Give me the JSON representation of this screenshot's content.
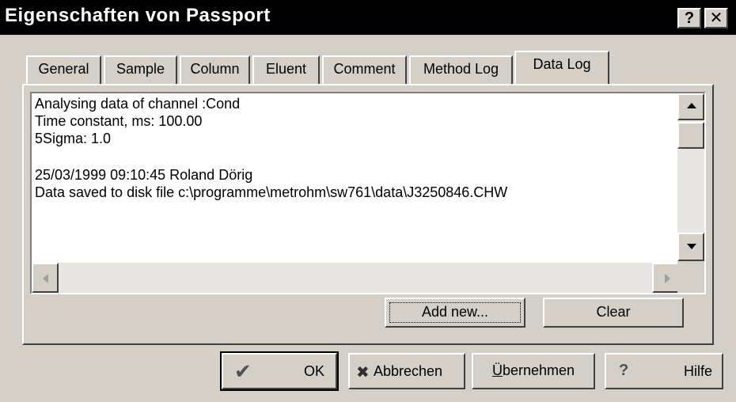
{
  "window": {
    "title": "Eigenschaften von Passport",
    "help_button": "?",
    "close_button": "✕"
  },
  "tabs": [
    {
      "label": "General"
    },
    {
      "label": "Sample"
    },
    {
      "label": "Column"
    },
    {
      "label": "Eluent"
    },
    {
      "label": "Comment"
    },
    {
      "label": "Method Log"
    },
    {
      "label": "Data Log",
      "active": true
    }
  ],
  "log": {
    "lines": [
      "Analysing data of channel :Cond",
      "Time constant, ms: 100.00",
      "5Sigma: 1.0",
      "",
      "25/03/1999 09:10:45 Roland Dörig",
      "Data saved to disk file c:\\programme\\metrohm\\sw761\\data\\J3250846.CHW"
    ]
  },
  "panel_buttons": {
    "add_new": "Add new...",
    "clear": "Clear"
  },
  "dialog_buttons": {
    "ok": "OK",
    "cancel": "Abbrechen",
    "apply_prefix": "Ü",
    "apply_rest": "bernehmen",
    "help_q": "?",
    "help": "Hilfe"
  }
}
